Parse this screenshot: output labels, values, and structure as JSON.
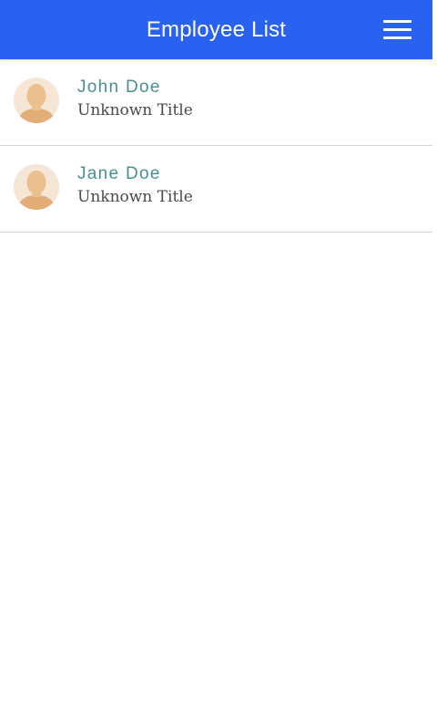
{
  "header": {
    "title": "Employee List",
    "menu_icon": "hamburger-menu-icon",
    "background_color": "#2962f0"
  },
  "employees": [
    {
      "name": "John Doe",
      "title": "Unknown Title",
      "avatar_icon": "person-silhouette-icon"
    },
    {
      "name": "Jane Doe",
      "title": "Unknown Title",
      "avatar_icon": "person-silhouette-icon"
    }
  ],
  "colors": {
    "name_text": "#4a8f93",
    "title_text": "#4a4a4a",
    "divider": "#d4d4d4",
    "avatar_background": "#f6e6d6",
    "avatar_figure": "#ebbf8e"
  }
}
